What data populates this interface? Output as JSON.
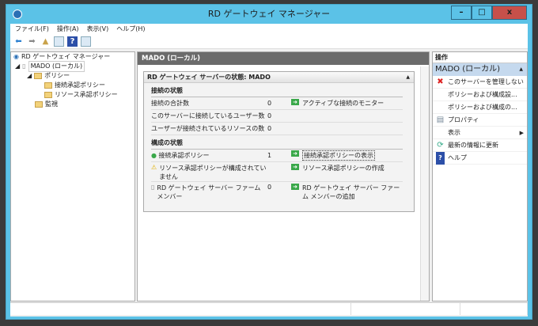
{
  "window": {
    "title": "RD ゲートウェイ マネージャー",
    "min": "–",
    "max": "□",
    "close": "x"
  },
  "menu": [
    "ファイル(F)",
    "操作(A)",
    "表示(V)",
    "ヘルプ(H)"
  ],
  "tree": {
    "root": "RD ゲートウェイ マネージャー",
    "server": "MADO (ローカル)",
    "policy": "ポリシー",
    "cap": "接続承認ポリシー",
    "rap": "リソース承認ポリシー",
    "monitor": "監視"
  },
  "center": {
    "header": "MADO (ローカル)",
    "panel_title": "RD ゲートウェイ サーバーの状態: MADO",
    "conn_section": "接続の状態",
    "conn_rows": [
      {
        "label": "接続の合計数",
        "value": "0",
        "action": "アクティブな接続のモニター"
      },
      {
        "label": "このサーバーに接続しているユーザー数",
        "value": "0",
        "action": ""
      },
      {
        "label": "ユーザーが接続されているリソースの数",
        "value": "0",
        "action": ""
      }
    ],
    "config_section": "構成の状態",
    "config_rows": [
      {
        "label": "接続承認ポリシー",
        "value": "1",
        "action": "接続承認ポリシーの表示"
      },
      {
        "label": "リソース承認ポリシーが構成されていません",
        "value": "",
        "action": "リソース承認ポリシーの作成"
      },
      {
        "label": "RD ゲートウェイ サーバー ファーム メンバー",
        "value": "0",
        "action": "RD ゲートウェイ サーバー ファーム メンバーの追加"
      }
    ]
  },
  "actions": {
    "header": "操作",
    "selected": "MADO (ローカル)",
    "items": [
      "このサーバーを管理しない",
      "ポリシーおよび構成設...",
      "ポリシーおよび構成の...",
      "プロパティ",
      "表示",
      "最新の情報に更新",
      "ヘルプ"
    ]
  }
}
